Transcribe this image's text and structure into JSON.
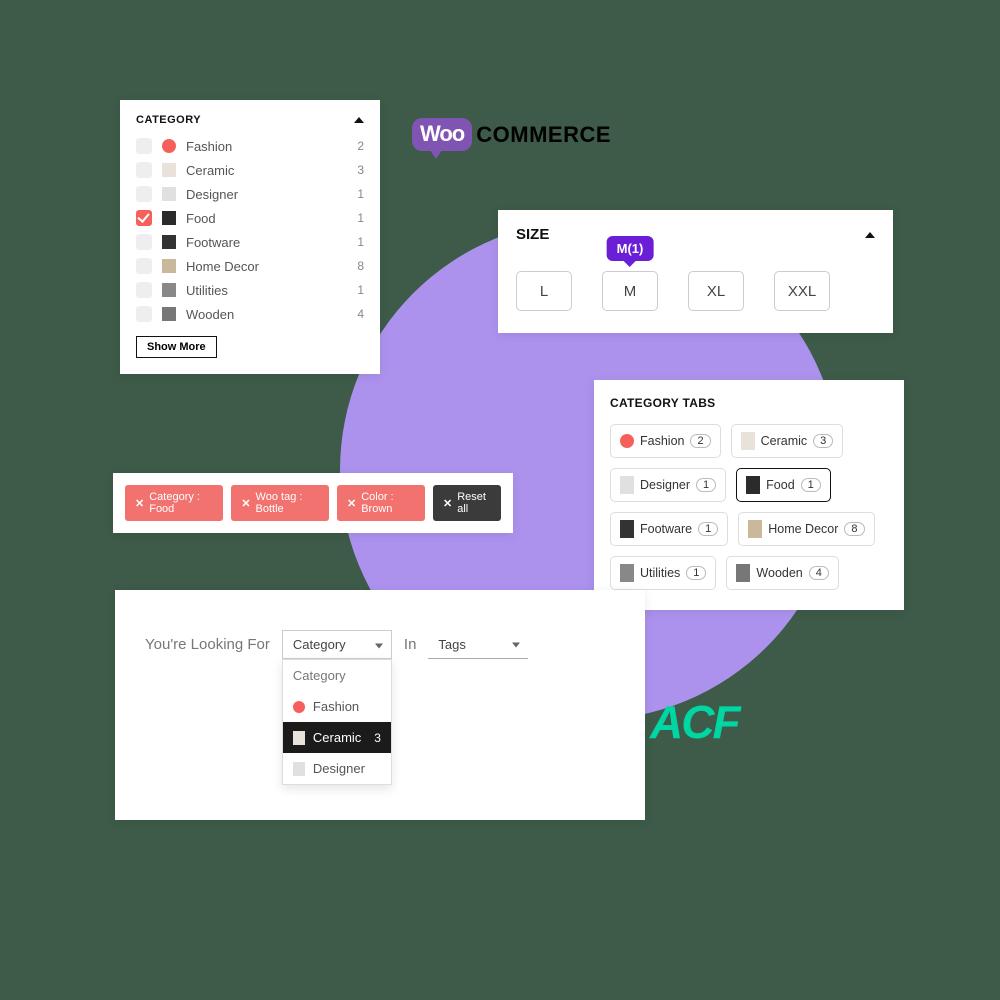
{
  "category_panel": {
    "title": "CATEGORY",
    "items": [
      {
        "label": "Fashion",
        "count": "2",
        "checked": false,
        "color": "#f5615a"
      },
      {
        "label": "Ceramic",
        "count": "3",
        "checked": false,
        "thumb": "#e8e2da"
      },
      {
        "label": "Designer",
        "count": "1",
        "checked": false,
        "thumb": "#e0e0e0"
      },
      {
        "label": "Food",
        "count": "1",
        "checked": true,
        "thumb": "#2b2b2b"
      },
      {
        "label": "Footware",
        "count": "1",
        "checked": false,
        "thumb": "#333"
      },
      {
        "label": "Home Decor",
        "count": "8",
        "checked": false,
        "thumb": "#c9b89a"
      },
      {
        "label": "Utilities",
        "count": "1",
        "checked": false,
        "thumb": "#888"
      },
      {
        "label": "Wooden",
        "count": "4",
        "checked": false,
        "thumb": "#777"
      }
    ],
    "show_more": "Show More"
  },
  "woo": {
    "bubble": "Woo",
    "text": "COMMERCE"
  },
  "size_panel": {
    "title": "SIZE",
    "tooltip": "M(1)",
    "options": [
      "L",
      "M",
      "XL",
      "XXL"
    ]
  },
  "tabs_panel": {
    "title": "CATEGORY TABS",
    "items": [
      {
        "label": "Fashion",
        "count": "2",
        "color": "#f5615a"
      },
      {
        "label": "Ceramic",
        "count": "3",
        "thumb": "#e8e2da"
      },
      {
        "label": "Designer",
        "count": "1",
        "thumb": "#e0e0e0"
      },
      {
        "label": "Food",
        "count": "1",
        "thumb": "#2b2b2b",
        "selected": true
      },
      {
        "label": "Footware",
        "count": "1",
        "thumb": "#333"
      },
      {
        "label": "Home Decor",
        "count": "8",
        "thumb": "#c9b89a"
      },
      {
        "label": "Utilities",
        "count": "1",
        "thumb": "#888"
      },
      {
        "label": "Wooden",
        "count": "4",
        "thumb": "#777"
      }
    ]
  },
  "chips": {
    "items": [
      {
        "label": "Category : Food",
        "variant": "pink"
      },
      {
        "label": "Woo tag : Bottle",
        "variant": "pink"
      },
      {
        "label": "Color : Brown",
        "variant": "pink"
      },
      {
        "label": "Reset all",
        "variant": "dark"
      }
    ]
  },
  "search": {
    "lead": "You're Looking For",
    "mid": "In",
    "select1": {
      "value": "Category",
      "head": "Category",
      "options": [
        {
          "label": "Fashion",
          "color": "#f5615a"
        },
        {
          "label": "Ceramic",
          "thumb": "#e8e2da",
          "count": "3",
          "hover": true
        },
        {
          "label": "Designer",
          "thumb": "#e0e0e0"
        }
      ]
    },
    "select2": {
      "value": "Tags"
    }
  },
  "acf": "ACF"
}
